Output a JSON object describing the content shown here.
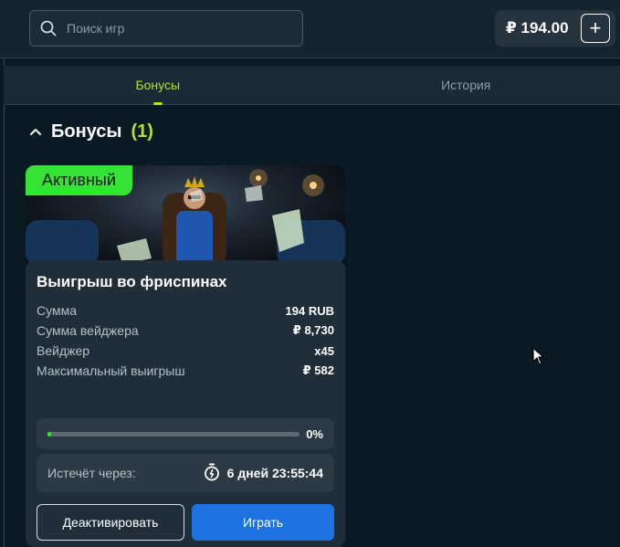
{
  "header": {
    "search_placeholder": "Поиск игр",
    "balance": "₽ 194.00",
    "add_funds_symbol": "+"
  },
  "tabs": [
    {
      "label": "Бонусы",
      "active": true
    },
    {
      "label": "История",
      "active": false
    }
  ],
  "section": {
    "title": "Бонусы",
    "count": "(1)"
  },
  "bonus_card": {
    "status_badge": "Активный",
    "title": "Выигрыш во фриспинах",
    "rows": [
      {
        "label": "Сумма",
        "value": "194 RUB"
      },
      {
        "label": "Сумма вейджера",
        "value": "₽ 8,730"
      },
      {
        "label": "Вейджер",
        "value": "x45"
      },
      {
        "label": "Максимальный выигрыш",
        "value": "₽ 582"
      }
    ],
    "progress_text": "0%",
    "progress_value": 0,
    "expiry_label": "Истечёт через:",
    "expiry_time": "6 дней 23:55:44",
    "deactivate_label": "Деактивировать",
    "play_label": "Играть"
  },
  "colors": {
    "accent_lime": "#b8e02a",
    "active_green": "#35e335",
    "primary_blue": "#1d73e2",
    "background": "#0a1a24"
  }
}
